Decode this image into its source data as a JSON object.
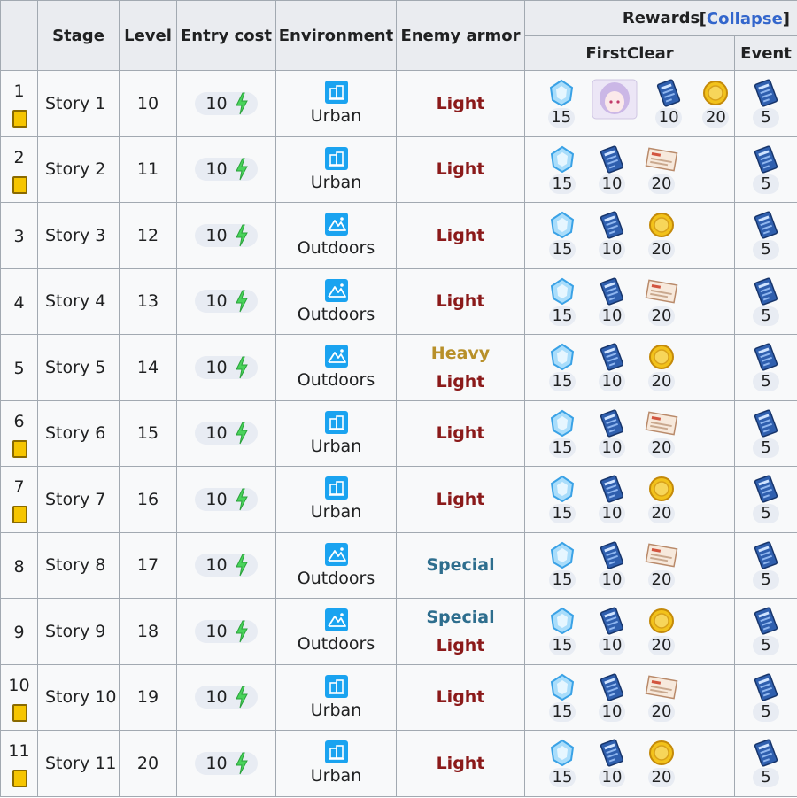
{
  "headers": {
    "stage": "Stage",
    "level": "Level",
    "entry_cost": "Entry cost",
    "environment": "Environment",
    "enemy_armor": "Enemy armor",
    "rewards": "Rewards",
    "collapse": "Collapse",
    "first_clear": "FirstClear",
    "event": "Event"
  },
  "colors": {
    "light": "#8b1a1a",
    "heavy": "#b8902a",
    "special": "#2e6e8e",
    "link": "#3366cc"
  },
  "rows": [
    {
      "num": "1",
      "book": true,
      "stage": "Story 1",
      "level": "10",
      "cost": "10",
      "env": "Urban",
      "armor": [
        "Light"
      ],
      "rewards": [
        {
          "icon": "gem-icon",
          "count": "15"
        },
        {
          "icon": "character-portrait",
          "count": ""
        },
        {
          "icon": "book-ticket-icon",
          "count": "10"
        },
        {
          "icon": "gold-coin-icon",
          "count": "20"
        }
      ],
      "event": "5"
    },
    {
      "num": "2",
      "book": true,
      "stage": "Story 2",
      "level": "11",
      "cost": "10",
      "env": "Urban",
      "armor": [
        "Light"
      ],
      "rewards": [
        {
          "icon": "gem-icon",
          "count": "15"
        },
        {
          "icon": "book-ticket-icon",
          "count": "10"
        },
        {
          "icon": "report-icon",
          "count": "20"
        }
      ],
      "event": "5"
    },
    {
      "num": "3",
      "book": false,
      "stage": "Story 3",
      "level": "12",
      "cost": "10",
      "env": "Outdoors",
      "armor": [
        "Light"
      ],
      "rewards": [
        {
          "icon": "gem-icon",
          "count": "15"
        },
        {
          "icon": "book-ticket-icon",
          "count": "10"
        },
        {
          "icon": "gold-coin-icon",
          "count": "20"
        }
      ],
      "event": "5"
    },
    {
      "num": "4",
      "book": false,
      "stage": "Story 4",
      "level": "13",
      "cost": "10",
      "env": "Outdoors",
      "armor": [
        "Light"
      ],
      "rewards": [
        {
          "icon": "gem-icon",
          "count": "15"
        },
        {
          "icon": "book-ticket-icon",
          "count": "10"
        },
        {
          "icon": "report-icon",
          "count": "20"
        }
      ],
      "event": "5"
    },
    {
      "num": "5",
      "book": false,
      "stage": "Story 5",
      "level": "14",
      "cost": "10",
      "env": "Outdoors",
      "armor": [
        "Heavy",
        "Light"
      ],
      "rewards": [
        {
          "icon": "gem-icon",
          "count": "15"
        },
        {
          "icon": "book-ticket-icon",
          "count": "10"
        },
        {
          "icon": "gold-coin-icon",
          "count": "20"
        }
      ],
      "event": "5"
    },
    {
      "num": "6",
      "book": true,
      "stage": "Story 6",
      "level": "15",
      "cost": "10",
      "env": "Urban",
      "armor": [
        "Light"
      ],
      "rewards": [
        {
          "icon": "gem-icon",
          "count": "15"
        },
        {
          "icon": "book-ticket-icon",
          "count": "10"
        },
        {
          "icon": "report-icon",
          "count": "20"
        }
      ],
      "event": "5"
    },
    {
      "num": "7",
      "book": true,
      "stage": "Story 7",
      "level": "16",
      "cost": "10",
      "env": "Urban",
      "armor": [
        "Light"
      ],
      "rewards": [
        {
          "icon": "gem-icon",
          "count": "15"
        },
        {
          "icon": "book-ticket-icon",
          "count": "10"
        },
        {
          "icon": "gold-coin-icon",
          "count": "20"
        }
      ],
      "event": "5"
    },
    {
      "num": "8",
      "book": false,
      "stage": "Story 8",
      "level": "17",
      "cost": "10",
      "env": "Outdoors",
      "armor": [
        "Special"
      ],
      "rewards": [
        {
          "icon": "gem-icon",
          "count": "15"
        },
        {
          "icon": "book-ticket-icon",
          "count": "10"
        },
        {
          "icon": "report-icon",
          "count": "20"
        }
      ],
      "event": "5"
    },
    {
      "num": "9",
      "book": false,
      "stage": "Story 9",
      "level": "18",
      "cost": "10",
      "env": "Outdoors",
      "armor": [
        "Special",
        "Light"
      ],
      "rewards": [
        {
          "icon": "gem-icon",
          "count": "15"
        },
        {
          "icon": "book-ticket-icon",
          "count": "10"
        },
        {
          "icon": "gold-coin-icon",
          "count": "20"
        }
      ],
      "event": "5"
    },
    {
      "num": "10",
      "book": true,
      "stage": "Story 10",
      "level": "19",
      "cost": "10",
      "env": "Urban",
      "armor": [
        "Light"
      ],
      "rewards": [
        {
          "icon": "gem-icon",
          "count": "15"
        },
        {
          "icon": "book-ticket-icon",
          "count": "10"
        },
        {
          "icon": "report-icon",
          "count": "20"
        }
      ],
      "event": "5"
    },
    {
      "num": "11",
      "book": true,
      "stage": "Story 11",
      "level": "20",
      "cost": "10",
      "env": "Urban",
      "armor": [
        "Light"
      ],
      "rewards": [
        {
          "icon": "gem-icon",
          "count": "15"
        },
        {
          "icon": "book-ticket-icon",
          "count": "10"
        },
        {
          "icon": "gold-coin-icon",
          "count": "20"
        }
      ],
      "event": "5"
    }
  ]
}
